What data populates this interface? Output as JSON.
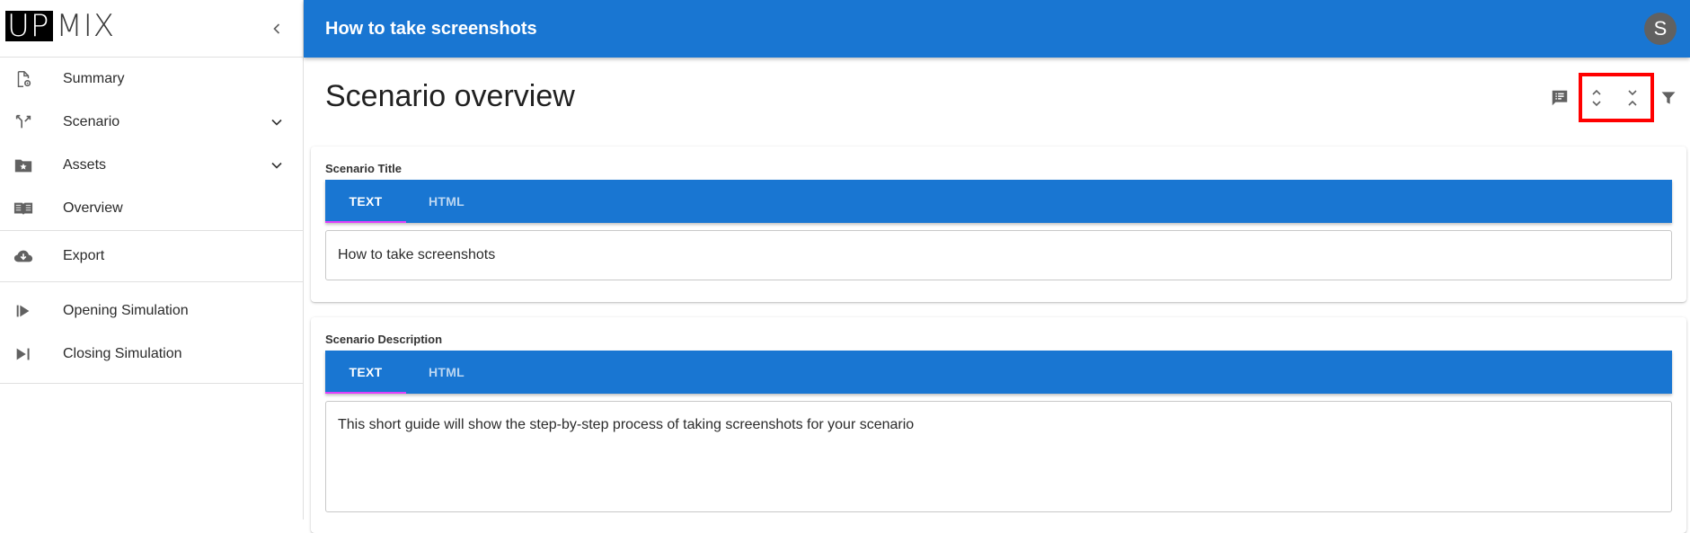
{
  "app": {
    "logo_left": "UP",
    "logo_right": "MIX"
  },
  "sidebar": {
    "items": [
      {
        "label": "Summary",
        "icon": "summary-settings-icon"
      },
      {
        "label": "Scenario",
        "icon": "scenario-branch-icon",
        "expandable": true
      },
      {
        "label": "Assets",
        "icon": "folder-star-icon",
        "expandable": true
      },
      {
        "label": "Overview",
        "icon": "book-open-icon"
      },
      {
        "label": "Export",
        "icon": "cloud-download-icon"
      },
      {
        "label": "Opening Simulation",
        "icon": "play-start-icon"
      },
      {
        "label": "Closing Simulation",
        "icon": "play-end-icon"
      }
    ]
  },
  "topbar": {
    "title": "How to take screenshots",
    "avatar_initial": "S"
  },
  "main": {
    "page_title": "Scenario overview",
    "toolbar_icons": [
      "comments-list-icon",
      "expand-all-icon",
      "collapse-all-icon",
      "filter-icon"
    ],
    "fields": [
      {
        "label": "Scenario Title",
        "tabs": [
          "TEXT",
          "HTML"
        ],
        "active_tab": "TEXT",
        "value": "How to take screenshots"
      },
      {
        "label": "Scenario Description",
        "tabs": [
          "TEXT",
          "HTML"
        ],
        "active_tab": "TEXT",
        "value": "This short guide will show the step-by-step process of taking screenshots for your scenario"
      }
    ]
  },
  "colors": {
    "primary": "#1976d2",
    "tab_indicator": "#e040fb",
    "highlight": "#ff0000",
    "avatar": "#616161"
  }
}
